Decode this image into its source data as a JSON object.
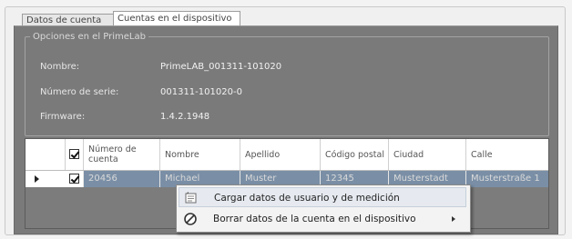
{
  "tabs": [
    {
      "label": "Datos de cuenta"
    },
    {
      "label": "Cuentas en el dispositivo"
    }
  ],
  "options": {
    "legend": "Opciones en el PrimeLab",
    "fields": [
      {
        "label": "Nombre:",
        "value": "PrimeLAB_001311-101020"
      },
      {
        "label": "Número de serie:",
        "value": "001311-101020-0"
      },
      {
        "label": "Firmware:",
        "value": "1.4.2.1948"
      }
    ]
  },
  "grid": {
    "columns": [
      "Número de cuenta",
      "Nombre",
      "Apellido",
      "Código postal",
      "Ciudad",
      "Calle"
    ],
    "rows": [
      {
        "checked": true,
        "cells": [
          "20456",
          "Michael",
          "Muster",
          "12345",
          "Musterstadt",
          "Musterstraße 1"
        ]
      }
    ]
  },
  "context_menu": {
    "items": [
      {
        "label": "Cargar datos de usuario y de medición"
      },
      {
        "label": "Borrar datos de la cuenta en el dispositivo"
      }
    ]
  }
}
